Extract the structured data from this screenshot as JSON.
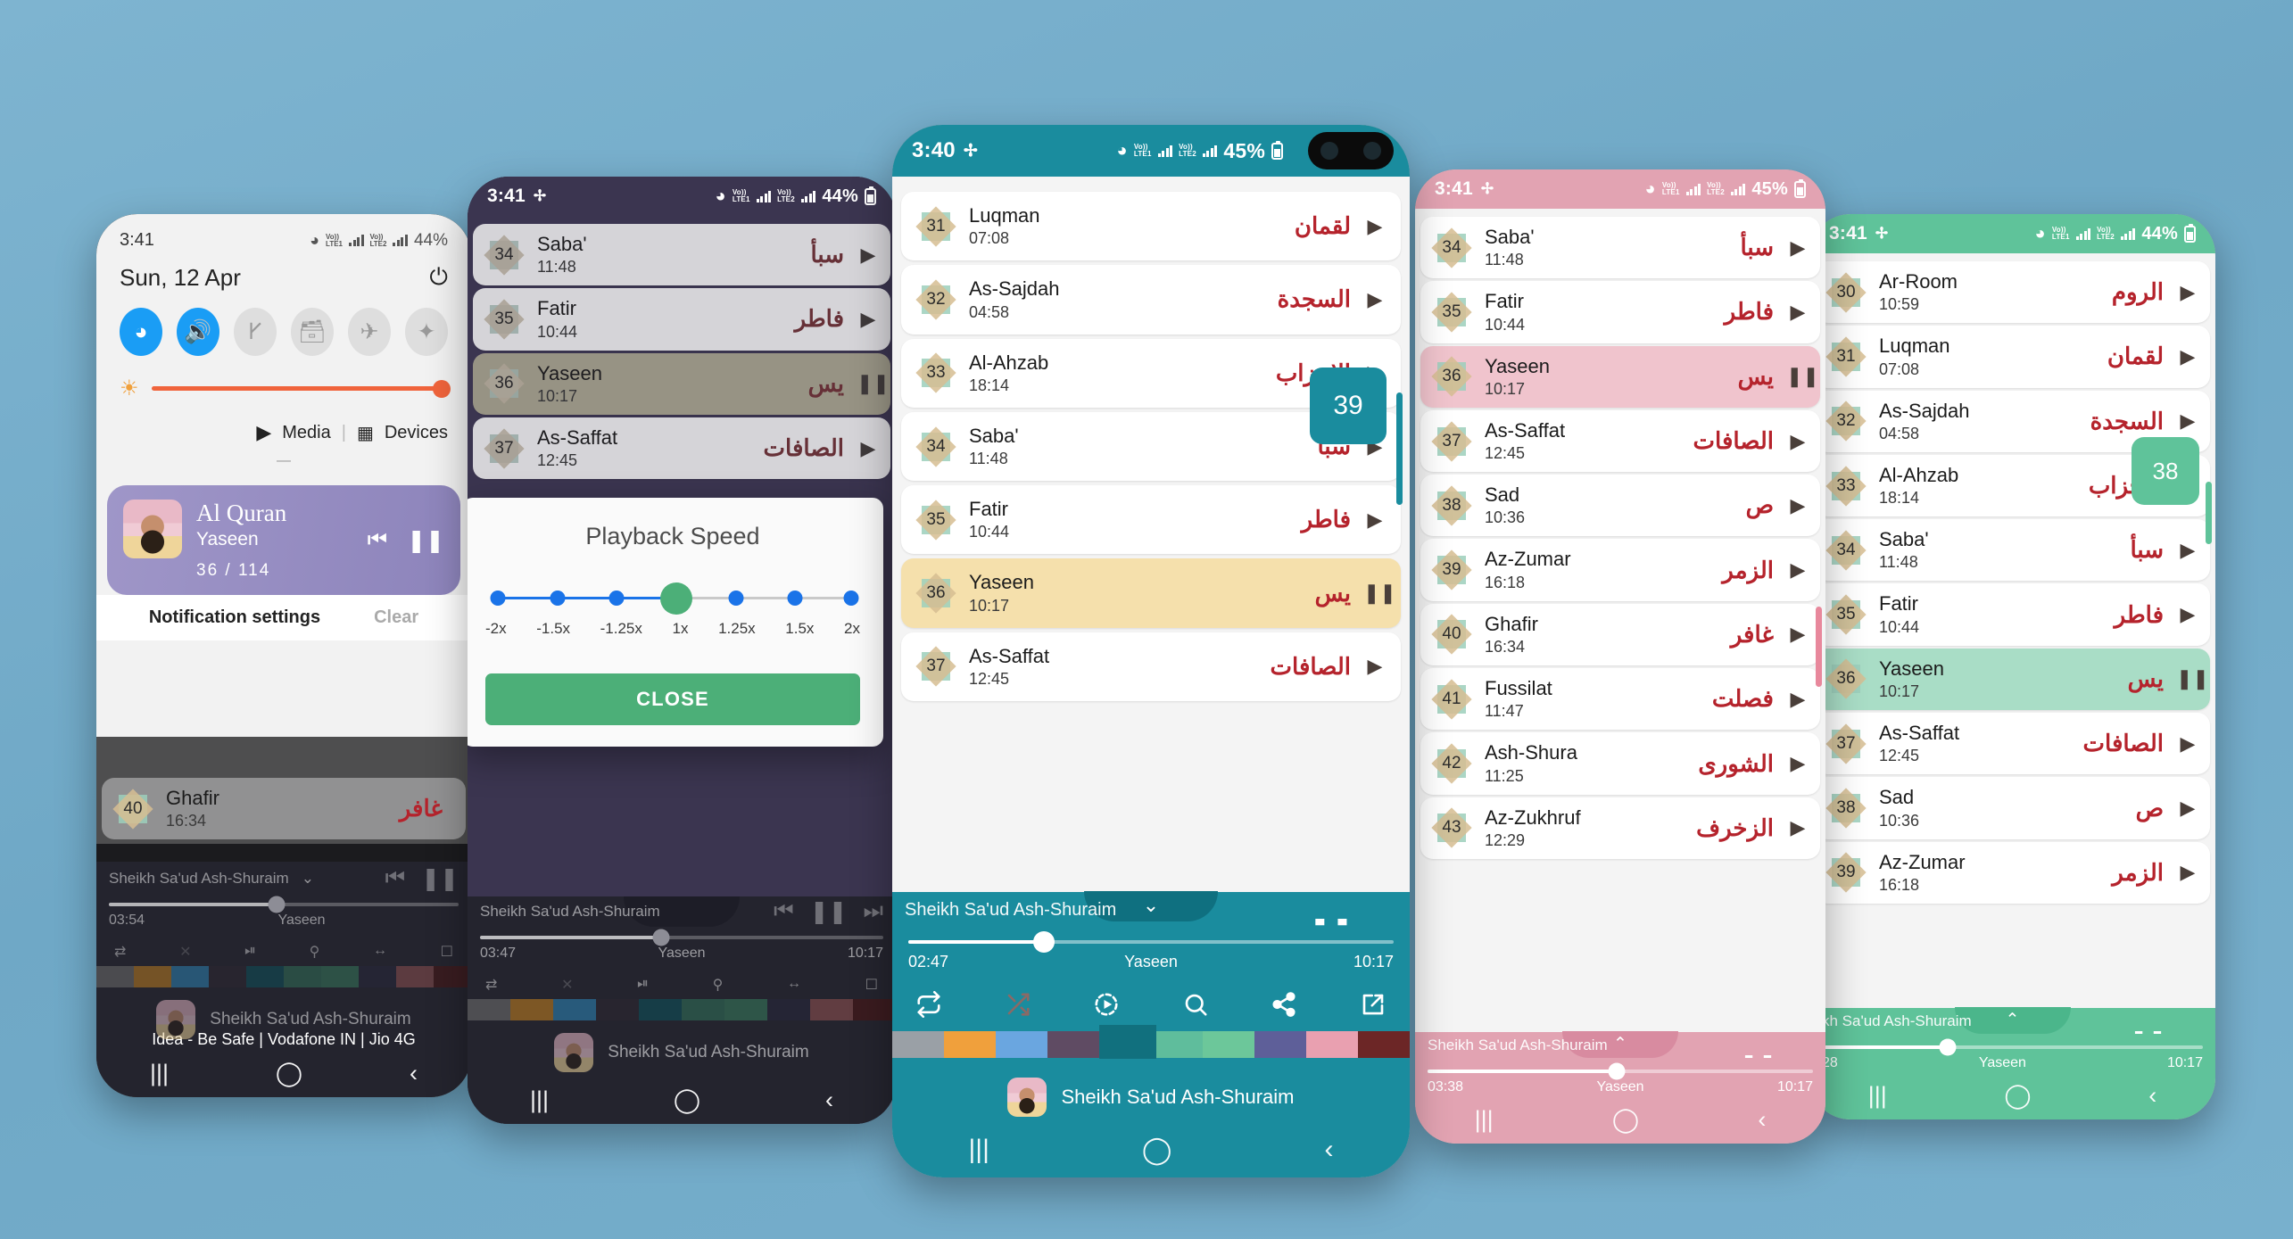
{
  "app": {
    "name": "Al Quran",
    "reciter": "Sheikh Sa'ud Ash-Shuraim"
  },
  "status": {
    "time_341": "3:41",
    "time_340": "3:40",
    "batt_44": "44%",
    "batt_45": "45%",
    "lte1": "LTE1",
    "lte2": "LTE2",
    "volte": "Vo))",
    "roam": "R"
  },
  "shade": {
    "time": "3:41",
    "battery": "44%",
    "date": "Sun, 12 Apr",
    "toggles": [
      {
        "name": "wifi",
        "on": true
      },
      {
        "name": "sound",
        "on": true
      },
      {
        "name": "bluetooth",
        "on": false
      },
      {
        "name": "sdcard",
        "on": false
      },
      {
        "name": "airplane",
        "on": false
      },
      {
        "name": "more",
        "on": false
      }
    ],
    "media_label": "Media",
    "devices_label": "Devices",
    "notification": {
      "app": "Al Quran",
      "track": "Yaseen",
      "counter": "36  /  114"
    },
    "actions": {
      "settings": "Notification settings",
      "clear": "Clear"
    },
    "bg_row": {
      "num": "40",
      "name": "Ghafir",
      "dur": "16:34",
      "ar": "غافر"
    },
    "mini": {
      "artist": "Sheikh Sa'ud Ash-Shuraim",
      "elapsed": "03:54",
      "track": "Yaseen"
    },
    "carrier": "Idea - Be Safe | Vodafone IN | Jio 4G"
  },
  "dialog": {
    "title": "Playback Speed",
    "close_label": "CLOSE",
    "options": [
      "-2x",
      "-1.5x",
      "-1.25x",
      "1x",
      "1.25x",
      "1.5x",
      "2x"
    ],
    "selected": "1x"
  },
  "phones": {
    "dark": {
      "accent": "#3b3550",
      "status_time": "3:41",
      "battery": "44%",
      "rows": [
        {
          "num": "34",
          "name": "Saba'",
          "dur": "11:48",
          "ar": "سبأ",
          "state": "play"
        },
        {
          "num": "35",
          "name": "Fatir",
          "dur": "10:44",
          "ar": "فاطر",
          "state": "play"
        },
        {
          "num": "36",
          "name": "Yaseen",
          "dur": "10:17",
          "ar": "يس",
          "state": "pause",
          "playing": true
        },
        {
          "num": "37",
          "name": "As-Saffat",
          "dur": "12:45",
          "ar": "الصافات",
          "state": "play"
        }
      ],
      "mini": {
        "artist": "Sheikh Sa'ud Ash-Shuraim",
        "elapsed": "03:47",
        "track": "Yaseen",
        "total": "10:17"
      },
      "footer_artist": "Sheikh Sa'ud Ash-Shuraim"
    },
    "center": {
      "accent": "#1a8c9e",
      "status_time": "3:40",
      "battery": "45%",
      "jump_badge": "39",
      "rows": [
        {
          "num": "31",
          "name": "Luqman",
          "dur": "07:08",
          "ar": "لقمان",
          "state": "play"
        },
        {
          "num": "32",
          "name": "As-Sajdah",
          "dur": "04:58",
          "ar": "السجدة",
          "state": "play"
        },
        {
          "num": "33",
          "name": "Al-Ahzab",
          "dur": "18:14",
          "ar": "الاحزاب",
          "state": "play"
        },
        {
          "num": "34",
          "name": "Saba'",
          "dur": "11:48",
          "ar": "سبأ",
          "state": "play"
        },
        {
          "num": "35",
          "name": "Fatir",
          "dur": "10:44",
          "ar": "فاطر",
          "state": "play"
        },
        {
          "num": "36",
          "name": "Yaseen",
          "dur": "10:17",
          "ar": "يس",
          "state": "pause",
          "playing": true
        },
        {
          "num": "37",
          "name": "As-Saffat",
          "dur": "12:45",
          "ar": "الصافات",
          "state": "play"
        }
      ],
      "mini": {
        "artist": "Sheikh Sa'ud Ash-Shuraim",
        "elapsed": "02:47",
        "track": "Yaseen",
        "total": "10:17"
      },
      "footer_artist": "Sheikh Sa'ud Ash-Shuraim",
      "theme_swatches": [
        "#9aa0a6",
        "#f0a03c",
        "#6aa6e0",
        "#5f4b63",
        "#11707e",
        "#5fbd9c",
        "#6cc79a",
        "#5e5f99",
        "#e9a0b0",
        "#6c2626"
      ],
      "theme_selected_index": 4
    },
    "pink": {
      "accent": "#e2a3b2",
      "status_time": "3:41",
      "battery": "45%",
      "rows": [
        {
          "num": "34",
          "name": "Saba'",
          "dur": "11:48",
          "ar": "سبأ",
          "state": "play"
        },
        {
          "num": "35",
          "name": "Fatir",
          "dur": "10:44",
          "ar": "فاطر",
          "state": "play"
        },
        {
          "num": "36",
          "name": "Yaseen",
          "dur": "10:17",
          "ar": "يس",
          "state": "pause",
          "playing": true
        },
        {
          "num": "37",
          "name": "As-Saffat",
          "dur": "12:45",
          "ar": "الصافات",
          "state": "play"
        },
        {
          "num": "38",
          "name": "Sad",
          "dur": "10:36",
          "ar": "ص",
          "state": "play"
        },
        {
          "num": "39",
          "name": "Az-Zumar",
          "dur": "16:18",
          "ar": "الزمر",
          "state": "play"
        },
        {
          "num": "40",
          "name": "Ghafir",
          "dur": "16:34",
          "ar": "غافر",
          "state": "play"
        },
        {
          "num": "41",
          "name": "Fussilat",
          "dur": "11:47",
          "ar": "فصلت",
          "state": "play"
        },
        {
          "num": "42",
          "name": "Ash-Shura",
          "dur": "11:25",
          "ar": "الشورى",
          "state": "play"
        },
        {
          "num": "43",
          "name": "Az-Zukhruf",
          "dur": "12:29",
          "ar": "الزخرف",
          "state": "play"
        }
      ],
      "mini": {
        "artist": "Sheikh Sa'ud Ash-Shuraim",
        "elapsed": "03:38",
        "track": "Yaseen",
        "total": "10:17"
      }
    },
    "green": {
      "accent": "#5fc39a",
      "status_time": "3:41",
      "battery": "44%",
      "jump_badge": "38",
      "rows": [
        {
          "num": "30",
          "name": "Ar-Room",
          "dur": "10:59",
          "ar": "الروم",
          "state": "play"
        },
        {
          "num": "31",
          "name": "Luqman",
          "dur": "07:08",
          "ar": "لقمان",
          "state": "play"
        },
        {
          "num": "32",
          "name": "As-Sajdah",
          "dur": "04:58",
          "ar": "السجدة",
          "state": "play"
        },
        {
          "num": "33",
          "name": "Al-Ahzab",
          "dur": "18:14",
          "ar": "الاحزاب",
          "state": "play"
        },
        {
          "num": "34",
          "name": "Saba'",
          "dur": "11:48",
          "ar": "سبأ",
          "state": "play"
        },
        {
          "num": "35",
          "name": "Fatir",
          "dur": "10:44",
          "ar": "فاطر",
          "state": "play"
        },
        {
          "num": "36",
          "name": "Yaseen",
          "dur": "10:17",
          "ar": "يس",
          "state": "pause",
          "playing": true
        },
        {
          "num": "37",
          "name": "As-Saffat",
          "dur": "12:45",
          "ar": "الصافات",
          "state": "play"
        },
        {
          "num": "38",
          "name": "Sad",
          "dur": "10:36",
          "ar": "ص",
          "state": "play"
        },
        {
          "num": "39",
          "name": "Az-Zumar",
          "dur": "16:18",
          "ar": "الزمر",
          "state": "play"
        }
      ],
      "mini": {
        "artist": "kh Sa'ud Ash-Shuraim",
        "elapsed": "28",
        "track": "Yaseen",
        "total": "10:17"
      }
    }
  }
}
